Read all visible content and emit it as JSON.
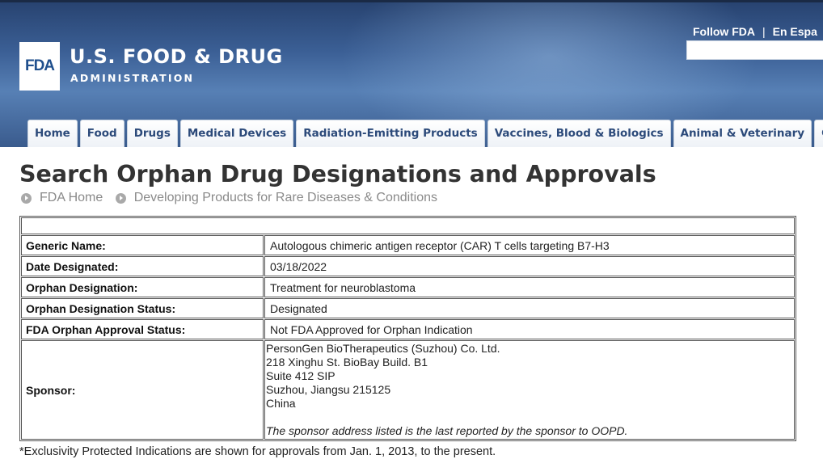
{
  "header": {
    "logo_text": "FDA",
    "brand_line1": "U.S. FOOD & DRUG",
    "brand_line2": "ADMINISTRATION",
    "follow_link": "Follow FDA",
    "separator": "|",
    "language_link": "En Espa",
    "colors": {
      "header_dark": "#27426f",
      "header_light": "#5780b5",
      "logo_blue": "#1f4f8d"
    }
  },
  "nav": {
    "tabs": [
      {
        "label": "Home"
      },
      {
        "label": "Food"
      },
      {
        "label": "Drugs"
      },
      {
        "label": "Medical Devices"
      },
      {
        "label": "Radiation-Emitting Products"
      },
      {
        "label": "Vaccines, Blood & Biologics"
      },
      {
        "label": "Animal & Veterinary"
      },
      {
        "label": "Cosme"
      }
    ]
  },
  "page": {
    "title": "Search Orphan Drug Designations and Approvals",
    "breadcrumb": [
      {
        "label": "FDA Home"
      },
      {
        "label": "Developing Products for Rare Diseases & Conditions"
      }
    ]
  },
  "details": {
    "rows": [
      {
        "label": "Generic Name:",
        "value": "Autologous chimeric antigen receptor (CAR) T cells targeting B7-H3"
      },
      {
        "label": "Date Designated:",
        "value": "03/18/2022"
      },
      {
        "label": "Orphan Designation:",
        "value": "Treatment for neuroblastoma"
      },
      {
        "label": "Orphan Designation Status:",
        "value": "Designated"
      },
      {
        "label": "FDA Orphan Approval Status:",
        "value": "Not FDA Approved for Orphan Indication"
      }
    ],
    "sponsor": {
      "label": "Sponsor:",
      "address_lines": [
        "PersonGen BioTherapeutics (Suzhou) Co. Ltd.",
        "218 Xinghu St. BioBay Build. B1",
        "Suite 412 SIP",
        "Suzhou, Jiangsu 215125",
        "China"
      ],
      "note": "The sponsor address listed is the last reported by the sponsor to OOPD."
    }
  },
  "footnote": "*Exclusivity Protected Indications are shown for approvals from Jan. 1, 2013, to the present."
}
